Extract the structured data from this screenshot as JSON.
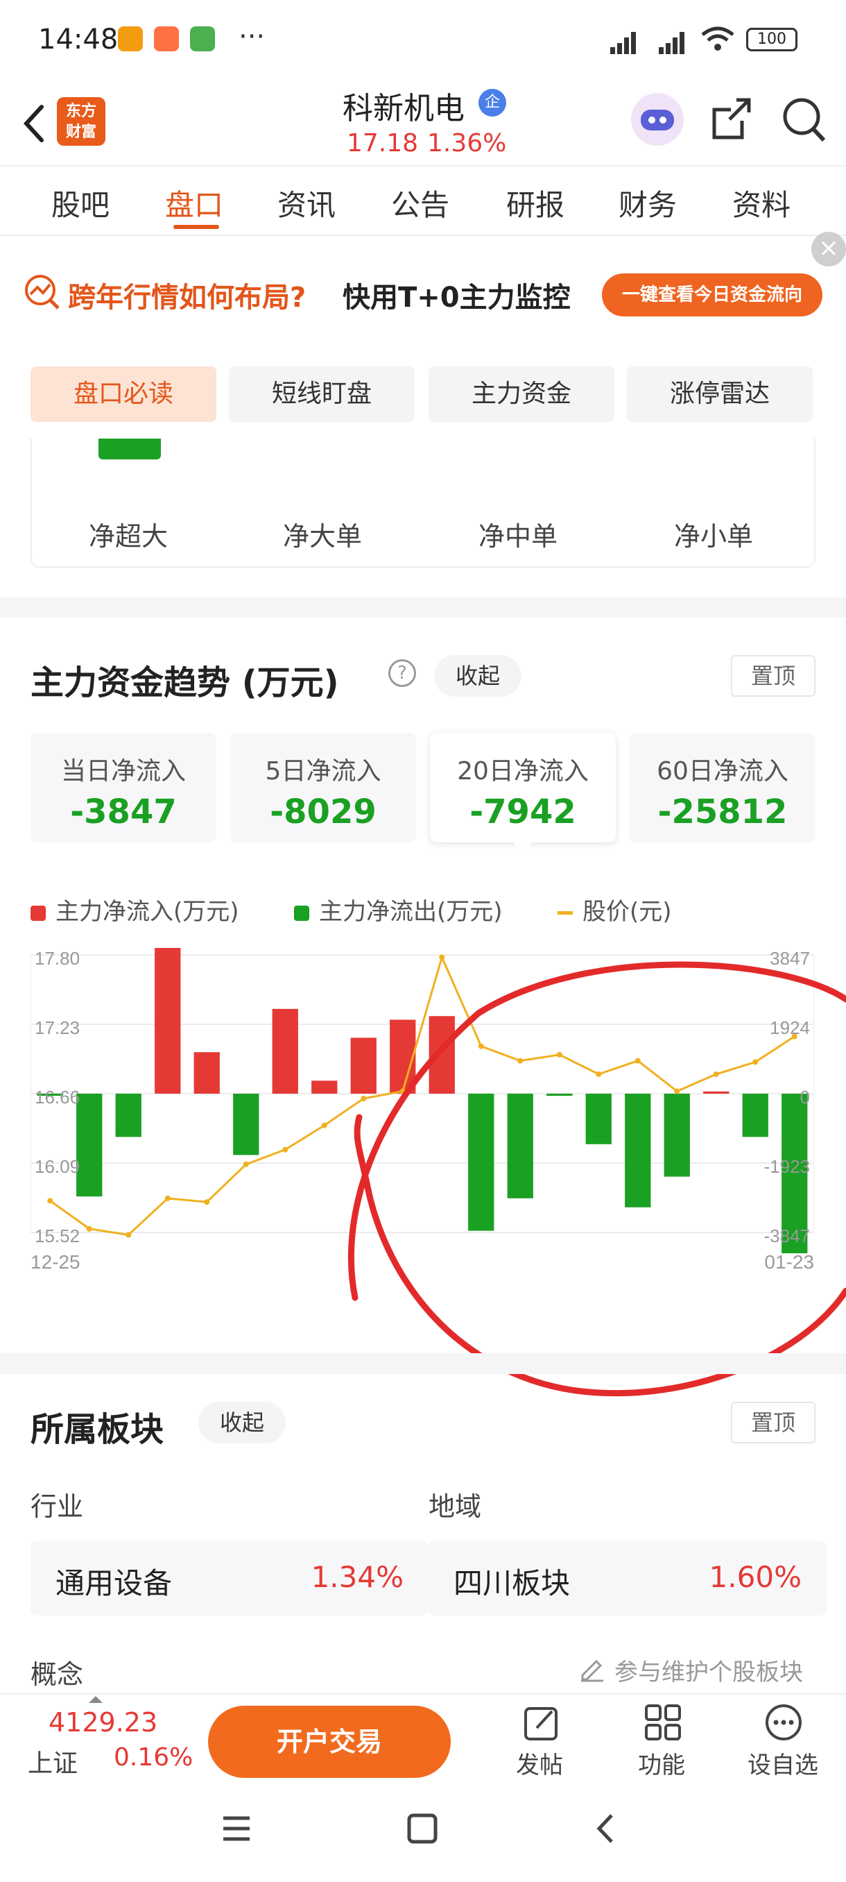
{
  "status_bar": {
    "time": "14:48",
    "battery": "100"
  },
  "header": {
    "stock_name": "科新机电",
    "badge": "企",
    "price": "17.18",
    "change_pct": "1.36%",
    "logo_text": "东方\n财富"
  },
  "tabs": [
    "股吧",
    "盘口",
    "资讯",
    "公告",
    "研报",
    "财务",
    "资料"
  ],
  "banner": {
    "text_orange": "跨年行情如何布局?",
    "text_black": "快用T+0主力监控",
    "button": "一键查看今日资金流向"
  },
  "sub_tabs": [
    "盘口必读",
    "短线盯盘",
    "主力资金",
    "涨停雷达"
  ],
  "order_types": [
    "净超大",
    "净大单",
    "净中单",
    "净小单"
  ],
  "trend": {
    "title": "主力资金趋势 (万元)",
    "collapse": "收起",
    "pin": "置顶",
    "stats": [
      {
        "label": "当日净流入",
        "value": "-3847"
      },
      {
        "label": "5日净流入",
        "value": "-8029"
      },
      {
        "label": "20日净流入",
        "value": "-7942"
      },
      {
        "label": "60日净流入",
        "value": "-25812"
      }
    ],
    "legend": {
      "inflow": "主力净流入(万元)",
      "outflow": "主力净流出(万元)",
      "price": "股价(元)"
    }
  },
  "colors": {
    "accent": "#e3561a",
    "up": "#e53935",
    "down": "#1aa022",
    "price_line": "#f0b020"
  },
  "chart_data": {
    "type": "bar",
    "x_start_label": "12-25",
    "x_end_label": "01-23",
    "left_ticks": [
      "17.80",
      "17.23",
      "16.66",
      "16.09",
      "15.52"
    ],
    "right_ticks": [
      "3847",
      "1924",
      "0",
      "-1923",
      "-3847"
    ],
    "flow_range": [
      -3847,
      3847
    ],
    "price_range": [
      15.52,
      17.8
    ],
    "flows": [
      -40,
      -2850,
      -1200,
      4800,
      1150,
      -1700,
      2350,
      360,
      1550,
      2050,
      2150,
      -3800,
      -2900,
      -60,
      -1400,
      -3150,
      -2300,
      60,
      -1200,
      -6100
    ],
    "prices": [
      15.78,
      15.55,
      15.5,
      15.8,
      15.77,
      16.08,
      16.2,
      16.4,
      16.62,
      16.68,
      17.78,
      17.05,
      16.93,
      16.98,
      16.82,
      16.93,
      16.68,
      16.82,
      16.92,
      17.13
    ]
  },
  "sector": {
    "title": "所属板块",
    "collapse": "收起",
    "pin": "置顶",
    "industry_label": "行业",
    "region_label": "地域",
    "industry": {
      "name": "通用设备",
      "pct": "1.34%"
    },
    "region": {
      "name": "四川板块",
      "pct": "1.60%"
    },
    "concept_label": "概念",
    "maintain": "参与维护个股板块"
  },
  "bottom": {
    "index_value": "4129.23",
    "index_name": "上证",
    "index_pct": "0.16%",
    "trade_button": "开户交易",
    "actions": [
      "发帖",
      "功能",
      "设自选"
    ]
  }
}
